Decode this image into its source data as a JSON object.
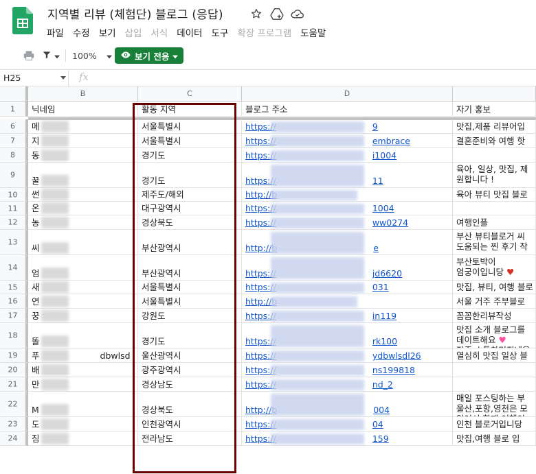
{
  "doc": {
    "title": "지역별 리뷰 (체험단) 블로그 (응답)",
    "icons": [
      "star-icon",
      "move-to-drive-icon",
      "cloud-status-icon"
    ]
  },
  "menu": [
    {
      "label": "파일",
      "disabled": false
    },
    {
      "label": "수정",
      "disabled": false
    },
    {
      "label": "보기",
      "disabled": false
    },
    {
      "label": "삽입",
      "disabled": true
    },
    {
      "label": "서식",
      "disabled": true
    },
    {
      "label": "데이터",
      "disabled": false
    },
    {
      "label": "도구",
      "disabled": false
    },
    {
      "label": "확장 프로그램",
      "disabled": true
    },
    {
      "label": "도움말",
      "disabled": false
    }
  ],
  "toolbar": {
    "zoom": "100%",
    "view_only": "보기 전용"
  },
  "formula": {
    "namebox": "H25",
    "fx": "fx"
  },
  "columns": [
    "B",
    "C",
    "D"
  ],
  "header_row": {
    "num": "1",
    "b": "닉네임",
    "c": "활동 지역",
    "d": "블로그 주소",
    "e": "자기 홍보"
  },
  "rows": [
    {
      "num": "6",
      "b": "메",
      "c": "서울특별시",
      "d1": "https://",
      "d2": "9",
      "e": [
        "맛집,제품 리뷰어입"
      ]
    },
    {
      "num": "7",
      "b": "지",
      "c": "서울특별시",
      "d1": "https://",
      "d2": "embrace",
      "e": [
        "결혼준비와 여행 핫"
      ]
    },
    {
      "num": "8",
      "b": "동",
      "c": "경기도",
      "d1": "https://",
      "d2": "i1004",
      "e": [
        ""
      ]
    },
    {
      "num": "9",
      "b": "꿀",
      "c": "경기도",
      "d1": "https://",
      "d2": "11",
      "e": [
        "육아, 일상, 맛집, 제",
        "원합니다 !"
      ]
    },
    {
      "num": "10",
      "b": "썬",
      "c": "제주도/해외",
      "d1": "http://b",
      "d2": "",
      "e": [
        "육아 뷰티 맛집 블로"
      ]
    },
    {
      "num": "11",
      "b": "온",
      "c": "대구광역시",
      "d1": "https://",
      "d2": "1004",
      "e": [
        ""
      ]
    },
    {
      "num": "12",
      "b": "농",
      "c": "경상북도",
      "d1": "https://",
      "d2": "ww0274",
      "e": [
        "여행인플"
      ]
    },
    {
      "num": "13",
      "b": "씨",
      "c": "부산광역시",
      "d1": "http://b",
      "d2": "e",
      "e": [
        "부산 뷰티블로거 씨",
        "도움되는 찐 후기 작"
      ]
    },
    {
      "num": "14",
      "b": "엄",
      "c": "부산광역시",
      "d1": "https://",
      "d2": "jd6620",
      "e": [
        "부산토박이",
        "엄궁이입니당"
      ]
    },
    {
      "num": "15",
      "b": "새",
      "c": "서울특별시",
      "d1": "https://",
      "d2": "031",
      "e": [
        "맛집, 뷰티, 여행 블로"
      ]
    },
    {
      "num": "16",
      "b": "연",
      "c": "서울특별시",
      "d1": "http://b",
      "d2": "",
      "e": [
        "서울 거주 주부블로"
      ]
    },
    {
      "num": "17",
      "b": "꿍",
      "c": "강원도",
      "d1": "https://",
      "d2": "in119",
      "e": [
        "꼼꼼한리뷰작성"
      ]
    },
    {
      "num": "18",
      "b": "똘",
      "c": "경기도",
      "d1": "https://",
      "d2": "rk100",
      "e": [
        "맛집 소개 블로그를",
        "데이트해요",
        "자주 소통하며지내용"
      ]
    },
    {
      "num": "19",
      "b": "푸",
      "b2": "dbwlsd",
      "c": "울산광역시",
      "d1": "https://",
      "d2": "ydbwlsdl26",
      "e": [
        "열심히 맛집 일상 블"
      ]
    },
    {
      "num": "20",
      "b": "배",
      "c": "광주광역시",
      "d1": "https://",
      "d2": "ns199818",
      "e": [
        ""
      ]
    },
    {
      "num": "21",
      "b": "만",
      "c": "경상남도",
      "d1": "https://",
      "d2": "nd_2",
      "e": [
        ""
      ]
    },
    {
      "num": "22",
      "b": "M",
      "c": "경상북도",
      "d1": "http://b",
      "d2": "004",
      "e": [
        "매일 포스팅하는 부",
        "울산,포항,영천은 모",
        "있어서 함께 여행이"
      ]
    },
    {
      "num": "23",
      "b": "도",
      "c": "인천광역시",
      "d1": "https://",
      "d2": "04",
      "e": [
        "인천 블로거입니당"
      ]
    },
    {
      "num": "24",
      "b": "짐",
      "c": "전라남도",
      "d1": "https://",
      "d2": "159",
      "e": [
        "맛집,여행 블로 입"
      ]
    }
  ]
}
